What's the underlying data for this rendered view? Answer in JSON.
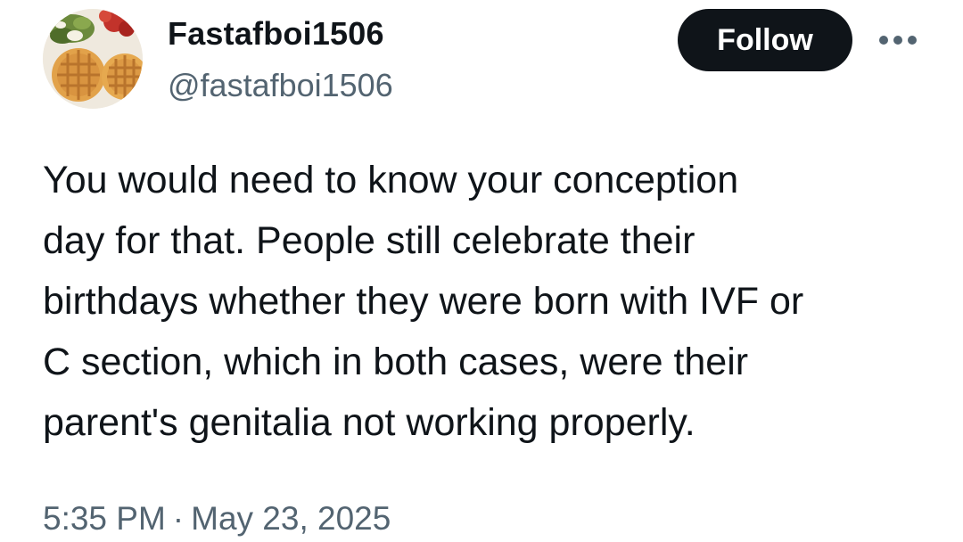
{
  "author": {
    "display_name": "Fastafboi1506",
    "handle": "@fastafboi1506",
    "avatar_icon": "waffles-plate-avatar"
  },
  "actions": {
    "follow_label": "Follow",
    "more_icon": "more-horizontal-icon"
  },
  "tweet": {
    "text_lines": [
      "You would need to know your conception",
      "day for that. People still celebrate their",
      "birthdays whether they were born with IVF or",
      "C section, which in both cases, were their",
      "parent's genitalia not working properly."
    ]
  },
  "meta": {
    "time": "5:35 PM",
    "separator": "·",
    "date": "May 23, 2025"
  },
  "colors": {
    "text_primary": "#0f1419",
    "text_secondary": "#536471",
    "follow_button_bg": "#0f1419",
    "follow_button_text": "#ffffff"
  }
}
